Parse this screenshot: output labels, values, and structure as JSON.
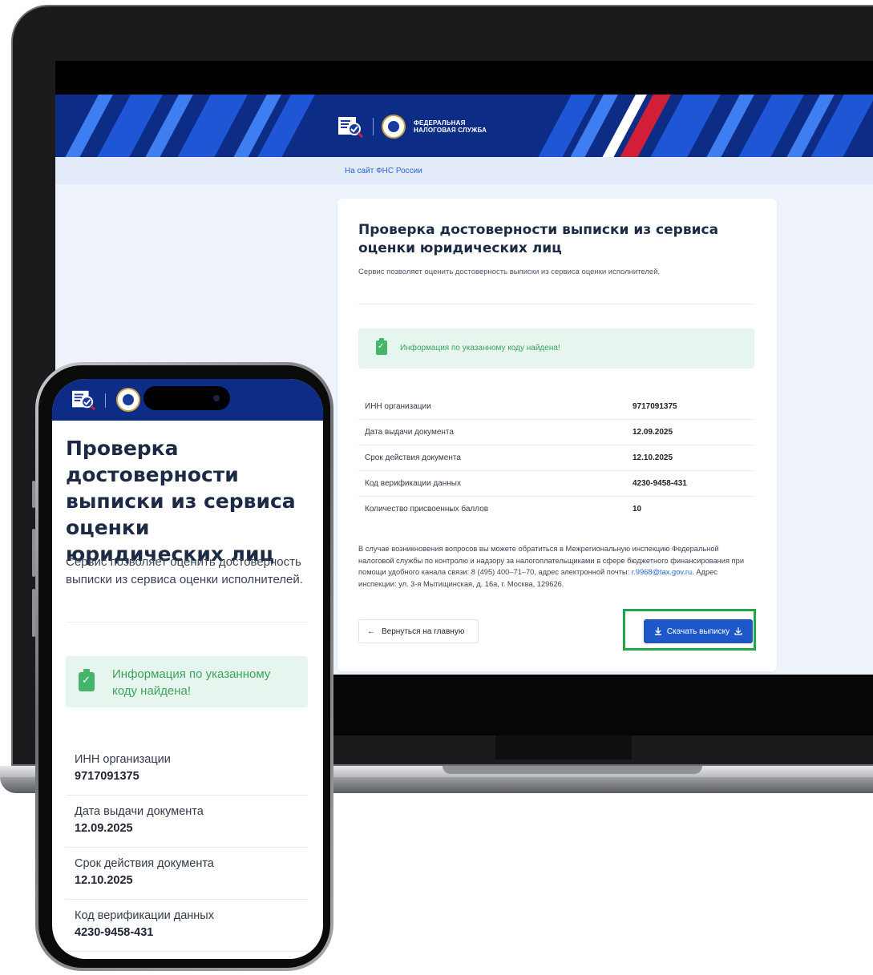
{
  "site": {
    "brand_line1": "ФЕДЕРАЛЬНАЯ",
    "brand_line2": "НАЛОГОВАЯ СЛУЖБА",
    "nav_link": "На сайт ФНС России"
  },
  "page": {
    "title": "Проверка достоверности выписки из сервиса оценки юридических лиц",
    "subtitle": "Сервис позволяет оценить достоверность выписки из сервиса оценки исполнителей.",
    "success_message": "Информация по указанному коду найдена!"
  },
  "details": [
    {
      "label": "ИНН организации",
      "value": "9717091375"
    },
    {
      "label": "Дата выдачи документа",
      "value": "12.09.2025"
    },
    {
      "label": "Срок действия документа",
      "value": "12.10.2025"
    },
    {
      "label": "Код верификации данных",
      "value": "4230-9458-431"
    },
    {
      "label": "Количество присвоенных баллов",
      "value": "10"
    }
  ],
  "contact": {
    "text_before": "В случае возникновения вопросов вы можете обратиться в Межрегиональную инспекцию Федеральной налоговой службы по контролю и надзору за налогоплательщиками в сфере бюджетного финансирования при помощи удобного канала связи: 8 (495) 400–71–70, адрес электронной почты: ",
    "email": "r.9968@tax.gov.ru",
    "text_after": ". Адрес инспекции: ул. 3-я Мытищинская, д. 16а, г. Москва, 129626."
  },
  "actions": {
    "back_label": "Вернуться на главную",
    "download_label": "Скачать выписку"
  },
  "icons": {
    "back": "arrow-left-icon",
    "download": "download-icon",
    "success": "clipboard-check-icon"
  },
  "colors": {
    "primary": "#1d57c9",
    "header": "#0c2c86",
    "success_bg": "#e6f6ee",
    "success_text": "#3aa35d",
    "highlight": "#1fa74a"
  }
}
